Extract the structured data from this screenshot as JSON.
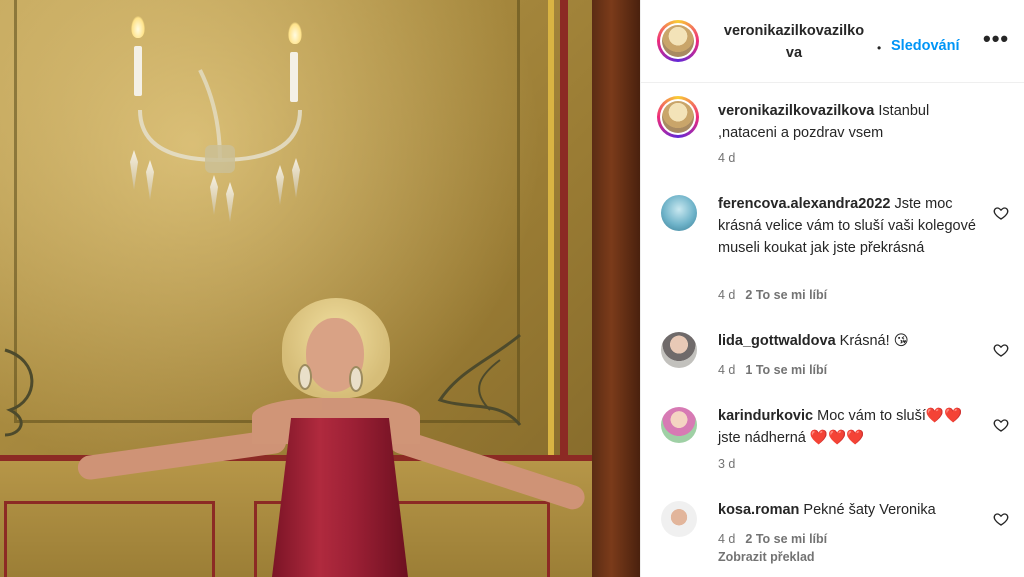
{
  "post": {
    "author": "veronikazilkovazilkova",
    "author_header_line1": "veronikazilkovazilko",
    "author_header_line2": "va",
    "separator": "•",
    "follow_label": "Sledování",
    "more_label": "•••"
  },
  "caption": {
    "username": "veronikazilkovazilkova",
    "text": " Istanbul ,nataceni a pozdrav vsem",
    "time": "4 d"
  },
  "comments": [
    {
      "username": "ferencova.alexandra2022",
      "text": " Jste moc krásná velice vám to sluší vaši kolegové museli koukat jak jste překrásná",
      "time": "4 d",
      "likes": "2 To se mi líbí"
    },
    {
      "username": "lida_gottwaldova",
      "text": " Krásná! ",
      "emoji": "😘",
      "time": "4 d",
      "likes": "1 To se mi líbí"
    },
    {
      "username": "karindurkovic",
      "text_a": " Moc vám to sluší",
      "emoji_a": "❤️",
      "emoji_b": "❤️",
      "text_b": " jste nádherná ",
      "emoji_c": "❤️❤️❤️",
      "time": "3 d",
      "likes": ""
    },
    {
      "username": "kosa.roman",
      "text": " Pekné šaty Veronika",
      "time": "4 d",
      "likes": "2 To se mi líbí",
      "translate_label": "Zobrazit překlad"
    }
  ],
  "icons": {
    "like": "heart-outline-icon",
    "more": "more-horizontal-icon"
  },
  "colors": {
    "link_blue": "#0095f6",
    "text_primary": "#262626",
    "text_secondary": "#737373"
  }
}
